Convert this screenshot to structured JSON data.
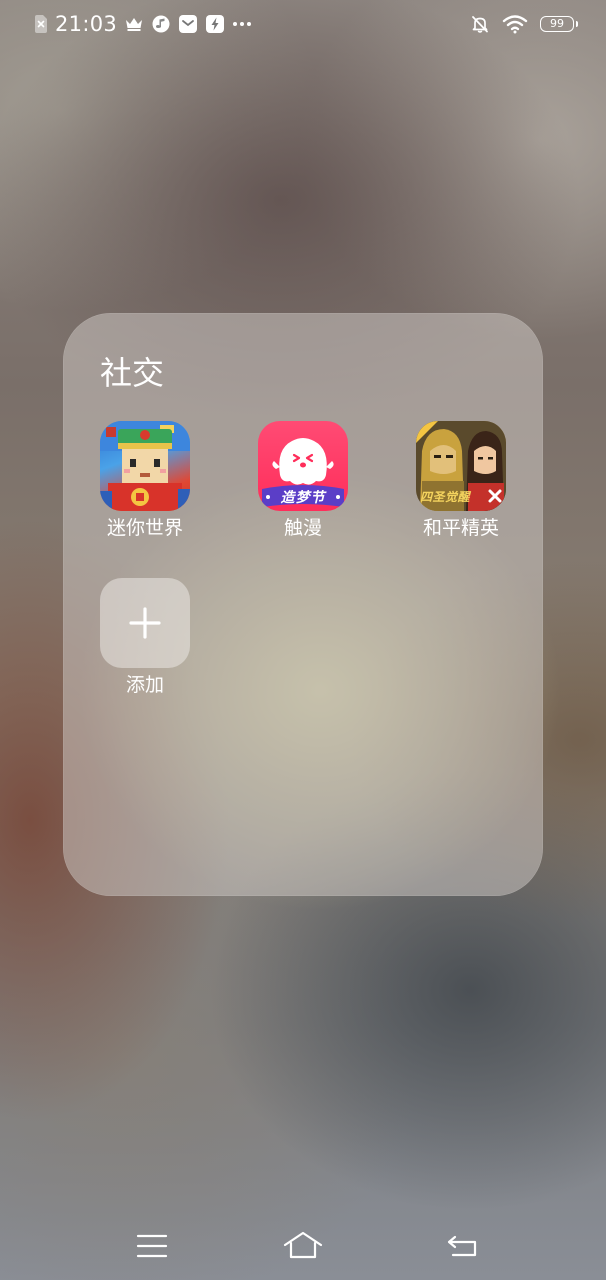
{
  "status_bar": {
    "time": "21:03",
    "battery": "99",
    "left_icons": [
      "sim-off-icon",
      "crown-icon",
      "music-app-icon",
      "mail-app-icon",
      "bolt-app-icon",
      "more-dots-icon"
    ],
    "right_icons": [
      "bell-off-icon",
      "wifi-icon",
      "battery-icon"
    ]
  },
  "folder": {
    "title": "社交",
    "apps": [
      {
        "label": "迷你世界",
        "icon": "mini-world-icon"
      },
      {
        "label": "触漫",
        "icon": "chuman-icon",
        "badge_text": "造梦节"
      },
      {
        "label": "和平精英",
        "icon": "peace-elite-icon",
        "badge_text": "四圣觉醒"
      }
    ],
    "add": {
      "label": "添加",
      "icon": "plus-icon"
    }
  },
  "nav_bar": {
    "buttons": [
      "menu-icon",
      "home-icon",
      "back-icon"
    ]
  },
  "colors": {
    "chuman_pink": "#ff2d5a",
    "chuman_banner": "#5b3ec7"
  }
}
